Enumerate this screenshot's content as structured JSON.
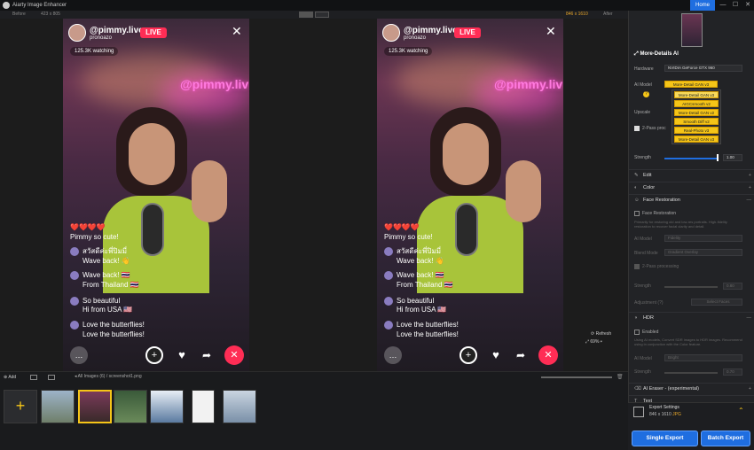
{
  "window": {
    "title": "Aiarty Image Enhancer",
    "home_label": "Home",
    "controls": [
      "—",
      "☐",
      "✕"
    ]
  },
  "viewbar": {
    "before_label": "Before",
    "before_size": "423 x 805",
    "after_size": "846 x 1610",
    "after_label": "After"
  },
  "stream": {
    "handle": "@pimmy.live",
    "sub": "pronoazo",
    "live": "LIVE",
    "watching": "125.3K watching",
    "neon": "@pimmy.liv",
    "chats": [
      {
        "text": "❤️❤️❤️❤️"
      },
      {
        "text": "Pimmy so cute!"
      },
      {
        "text": "สวัสดีค่ะพี่ปิมมี่"
      },
      {
        "text": "Wave back! 👋"
      },
      {
        "text": "Wave back! 🇹🇭"
      },
      {
        "text": "From Thailand 🇹🇭"
      },
      {
        "text": "So beautiful"
      },
      {
        "text": "Hi from USA 🇺🇸"
      },
      {
        "text": "Love the butterflies!"
      },
      {
        "text": "Love the butterflies!"
      }
    ]
  },
  "zoom": {
    "refresh": "Refresh",
    "level": "69%"
  },
  "toolbar": {
    "add": "Add",
    "all_images": "All Images (6)",
    "separator": "/",
    "filename": "screenshot1.png"
  },
  "panel": {
    "more_details": "More-Details AI",
    "hardware_label": "Hardware",
    "hardware_value": "NVIDIA GeForce GTX 960",
    "ai_model_label": "AI Model",
    "ai_model_value": "More-Detail GAN v3",
    "model_options": [
      "More-Detail GAN v3",
      "AIGCsmooth v2",
      "More-Detail GAN v2",
      "Smooth Diff v2",
      "Real-Photo v3",
      "More-Detail GAN v3"
    ],
    "upscale_label": "Upscale",
    "two_pass": "2-Pass proc",
    "strength_label": "Strength",
    "strength_value": "1.00",
    "strength_level": 1.0,
    "edit": "Edit",
    "color": "Color",
    "face_restoration": "Face Restoration",
    "face_checkbox": "Face Restoration",
    "face_desc": "Primarily for restoring old and low-res portraits. High-fidelity restoration to recover facial clarity and detail.",
    "fr_model_label": "AI Model",
    "fr_model_value": "Fidelity",
    "blend_label": "Blend Mode",
    "blend_value": "Gradient Overlay",
    "fr_two_pass": "2-Pass processing",
    "fr_strength_label": "Strength",
    "fr_strength_value": "0.80",
    "fr_adjust_label": "Adjustment (?)",
    "fr_adjust_btn": "Select Faces",
    "hdr": "HDR",
    "hdr_enabled": "Enabled",
    "hdr_desc": "Using AI models, Convert SDR images to HDR images. Recommend using in conjunction with the Color feature.",
    "hdr_model_label": "AI Model",
    "hdr_model_value": "Bright",
    "hdr_strength_label": "Strength",
    "hdr_strength_value": "0.70",
    "eraser": "AI Eraser - (experimental)",
    "text": "Text",
    "export_settings": "Export Settings",
    "export_size": "846 x 1610",
    "export_fmt": "JPG",
    "single_export": "Single Export",
    "batch_export": "Batch Export"
  },
  "colors": {
    "accent": "#1f6ee0",
    "live": "#ff2d55",
    "highlight": "#f5c518"
  }
}
